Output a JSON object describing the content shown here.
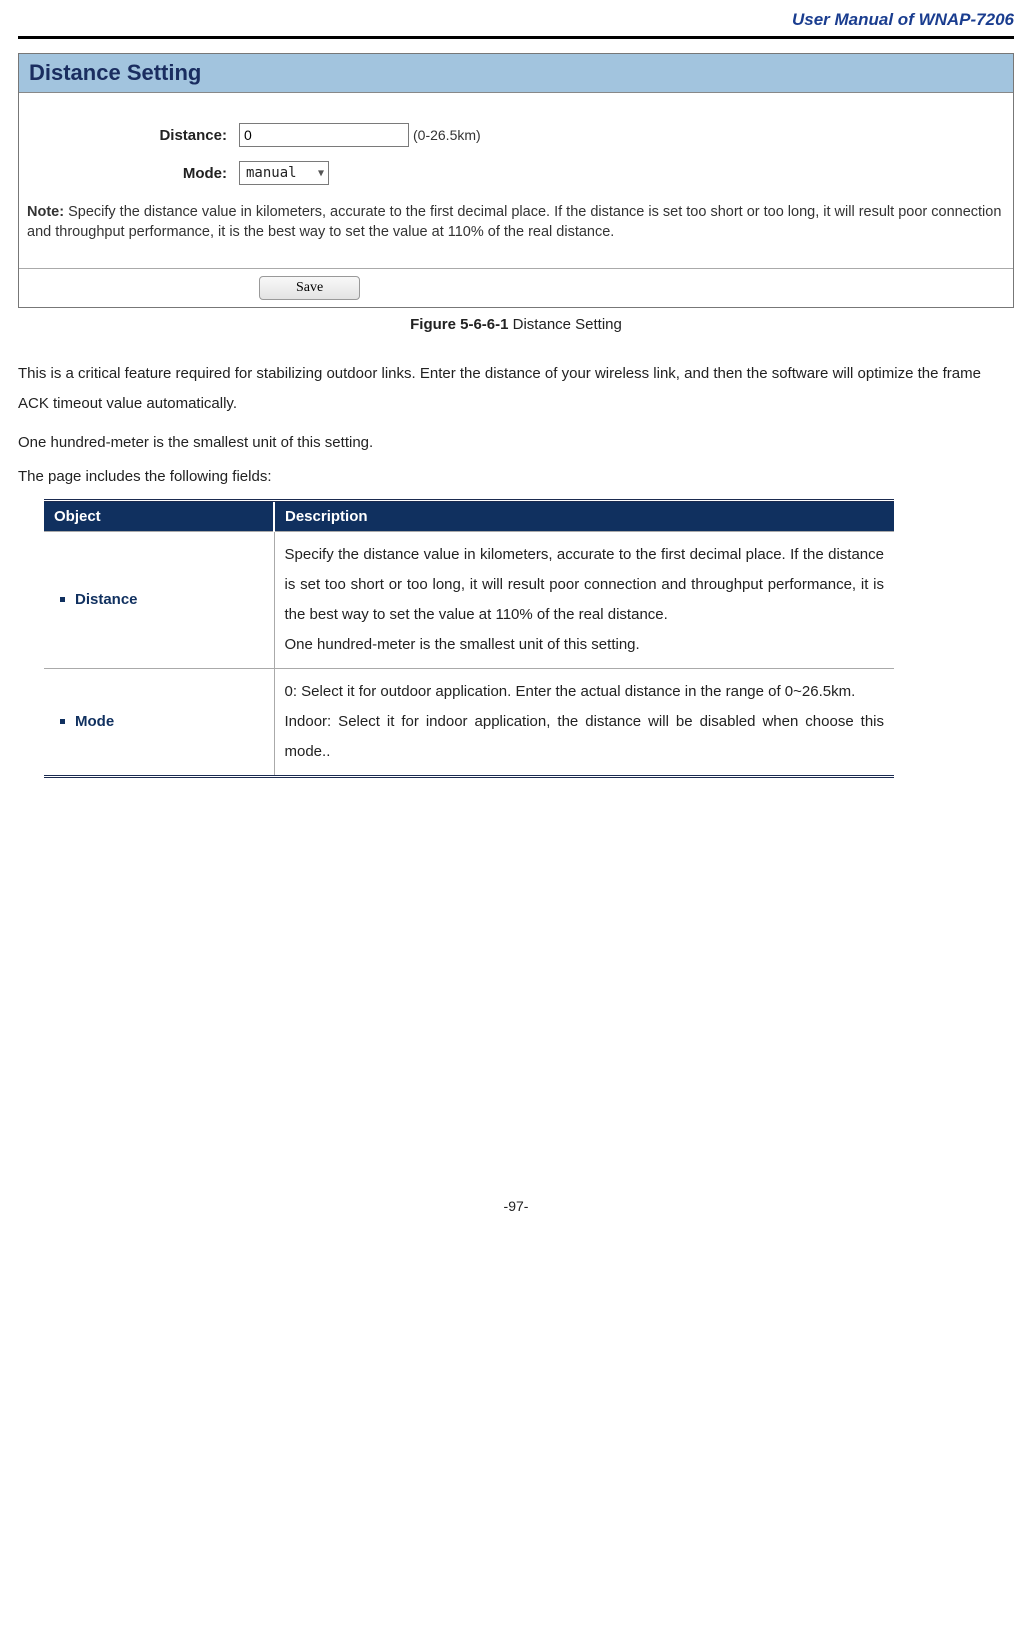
{
  "header": {
    "title": "User Manual of WNAP-7206"
  },
  "panel": {
    "title": "Distance Setting",
    "distance_label": "Distance:",
    "distance_value": "0",
    "distance_hint": "(0-26.5km)",
    "mode_label": "Mode:",
    "mode_value": "manual",
    "note_label": "Note:",
    "note_text": "Specify the distance value in kilometers, accurate to the first decimal place. If the distance is set too short or too long, it will result poor connection and throughput performance, it is the best way to set the value at 110% of the real distance.",
    "save_label": "Save"
  },
  "figure": {
    "prefix": "Figure 5-6-6-1",
    "caption": "Distance Setting"
  },
  "paragraphs": {
    "p1": "This is a critical feature required for stabilizing outdoor links. Enter the distance of your wireless link, and then the software will optimize the frame ACK timeout value automatically.",
    "p2": "One hundred-meter is the smallest unit of this setting.",
    "p3": "The page includes the following fields:"
  },
  "table": {
    "head_object": "Object",
    "head_description": "Description",
    "rows": [
      {
        "object": "Distance",
        "description": "Specify the distance value in kilometers, accurate to the first decimal place. If the distance is set too short or too long, it will result poor connection and throughput performance, it is the best way to set the value at 110% of the real distance.\nOne hundred-meter is the smallest unit of this setting."
      },
      {
        "object": "Mode",
        "description": "0: Select it for outdoor application. Enter the actual distance in the range of 0~26.5km.\nIndoor: Select it for indoor application, the distance will be disabled when choose this mode.."
      }
    ]
  },
  "footer": {
    "page_number": "-97-"
  }
}
